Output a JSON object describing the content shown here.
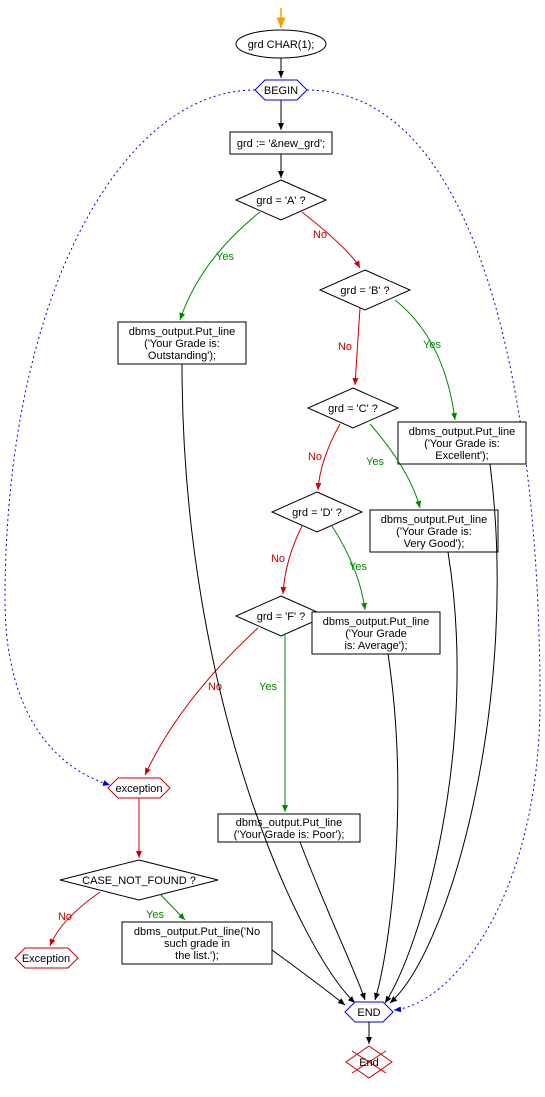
{
  "chart_data": {
    "type": "diagram",
    "title": "",
    "nodes": [
      {
        "id": "declare",
        "shape": "ellipse",
        "label": "grd CHAR(1);"
      },
      {
        "id": "begin",
        "shape": "hexagon",
        "label": "BEGIN",
        "color": "blue"
      },
      {
        "id": "assign",
        "shape": "rect",
        "label": "grd := '&new_grd';"
      },
      {
        "id": "checkA",
        "shape": "diamond",
        "label": "grd = 'A' ?"
      },
      {
        "id": "checkB",
        "shape": "diamond",
        "label": "grd = 'B' ?"
      },
      {
        "id": "checkC",
        "shape": "diamond",
        "label": "grd = 'C' ?"
      },
      {
        "id": "checkD",
        "shape": "diamond",
        "label": "grd = 'D' ?"
      },
      {
        "id": "checkF",
        "shape": "diamond",
        "label": "grd = 'F' ?"
      },
      {
        "id": "outA",
        "shape": "rect",
        "label": "dbms_output.Put_line ('Your Grade is: Outstanding');"
      },
      {
        "id": "outB",
        "shape": "rect",
        "label": "dbms_output.Put_line ('Your Grade is: Excellent');"
      },
      {
        "id": "outC",
        "shape": "rect",
        "label": "dbms_output.Put_line ('Your Grade is: Very Good');"
      },
      {
        "id": "outD",
        "shape": "rect",
        "label": "dbms_output.Put_line ('Your Grade is: Average');"
      },
      {
        "id": "outF",
        "shape": "rect",
        "label": "dbms_output.Put_line ('Your Grade is: Poor');"
      },
      {
        "id": "exception",
        "shape": "hexagon",
        "label": "exception",
        "color": "red"
      },
      {
        "id": "caseNotFound",
        "shape": "diamond",
        "label": "CASE_NOT_FOUND ?"
      },
      {
        "id": "exceptionEnd",
        "shape": "hexagon",
        "label": "Exception",
        "color": "red"
      },
      {
        "id": "outNoGrade",
        "shape": "rect",
        "label": "dbms_output.Put_line('No such grade in the list.');"
      },
      {
        "id": "endHex",
        "shape": "hexagon",
        "label": "END",
        "color": "blue"
      },
      {
        "id": "endDiamond",
        "shape": "diamond-crossed",
        "label": "End"
      }
    ],
    "edges": [
      {
        "from": "start",
        "to": "declare"
      },
      {
        "from": "declare",
        "to": "begin"
      },
      {
        "from": "begin",
        "to": "assign"
      },
      {
        "from": "assign",
        "to": "checkA"
      },
      {
        "from": "checkA",
        "to": "outA",
        "label": "Yes"
      },
      {
        "from": "checkA",
        "to": "checkB",
        "label": "No"
      },
      {
        "from": "checkB",
        "to": "outB",
        "label": "Yes"
      },
      {
        "from": "checkB",
        "to": "checkC",
        "label": "No"
      },
      {
        "from": "checkC",
        "to": "outC",
        "label": "Yes"
      },
      {
        "from": "checkC",
        "to": "checkD",
        "label": "No"
      },
      {
        "from": "checkD",
        "to": "outD",
        "label": "Yes"
      },
      {
        "from": "checkD",
        "to": "checkF",
        "label": "No"
      },
      {
        "from": "checkF",
        "to": "outF",
        "label": "Yes"
      },
      {
        "from": "checkF",
        "to": "exception",
        "label": "No"
      },
      {
        "from": "exception",
        "to": "caseNotFound"
      },
      {
        "from": "caseNotFound",
        "to": "outNoGrade",
        "label": "Yes"
      },
      {
        "from": "caseNotFound",
        "to": "exceptionEnd",
        "label": "No"
      },
      {
        "from": "outA",
        "to": "endHex"
      },
      {
        "from": "outB",
        "to": "endHex"
      },
      {
        "from": "outC",
        "to": "endHex"
      },
      {
        "from": "outD",
        "to": "endHex"
      },
      {
        "from": "outF",
        "to": "endHex"
      },
      {
        "from": "outNoGrade",
        "to": "endHex"
      },
      {
        "from": "endHex",
        "to": "endDiamond"
      },
      {
        "from": "begin",
        "to": "exception",
        "style": "dotted"
      },
      {
        "from": "begin",
        "to": "endHex",
        "style": "dotted"
      }
    ]
  },
  "labels": {
    "yes": "Yes",
    "no": "No"
  }
}
